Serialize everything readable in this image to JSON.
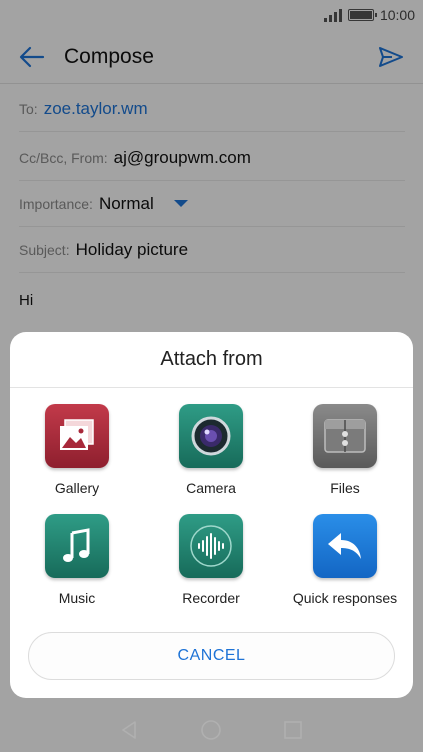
{
  "status_bar": {
    "time": "10:00"
  },
  "app_bar": {
    "title": "Compose"
  },
  "fields": {
    "to_label": "To:",
    "to_value": "zoe.taylor.wm",
    "from_label": "Cc/Bcc, From:",
    "from_value": "aj@groupwm.com",
    "importance_label": "Importance:",
    "importance_value": "Normal",
    "subject_label": "Subject:",
    "subject_value": "Holiday picture"
  },
  "body": {
    "text": "Hi"
  },
  "attach_sheet": {
    "title": "Attach from",
    "apps": [
      {
        "label": "Gallery",
        "icon": "gallery-icon"
      },
      {
        "label": "Camera",
        "icon": "camera-icon"
      },
      {
        "label": "Files",
        "icon": "files-icon"
      },
      {
        "label": "Music",
        "icon": "music-icon"
      },
      {
        "label": "Recorder",
        "icon": "recorder-icon"
      },
      {
        "label": "Quick responses",
        "icon": "quick-responses-icon"
      }
    ],
    "cancel_label": "CANCEL"
  },
  "colors": {
    "accent": "#1e73d6"
  }
}
